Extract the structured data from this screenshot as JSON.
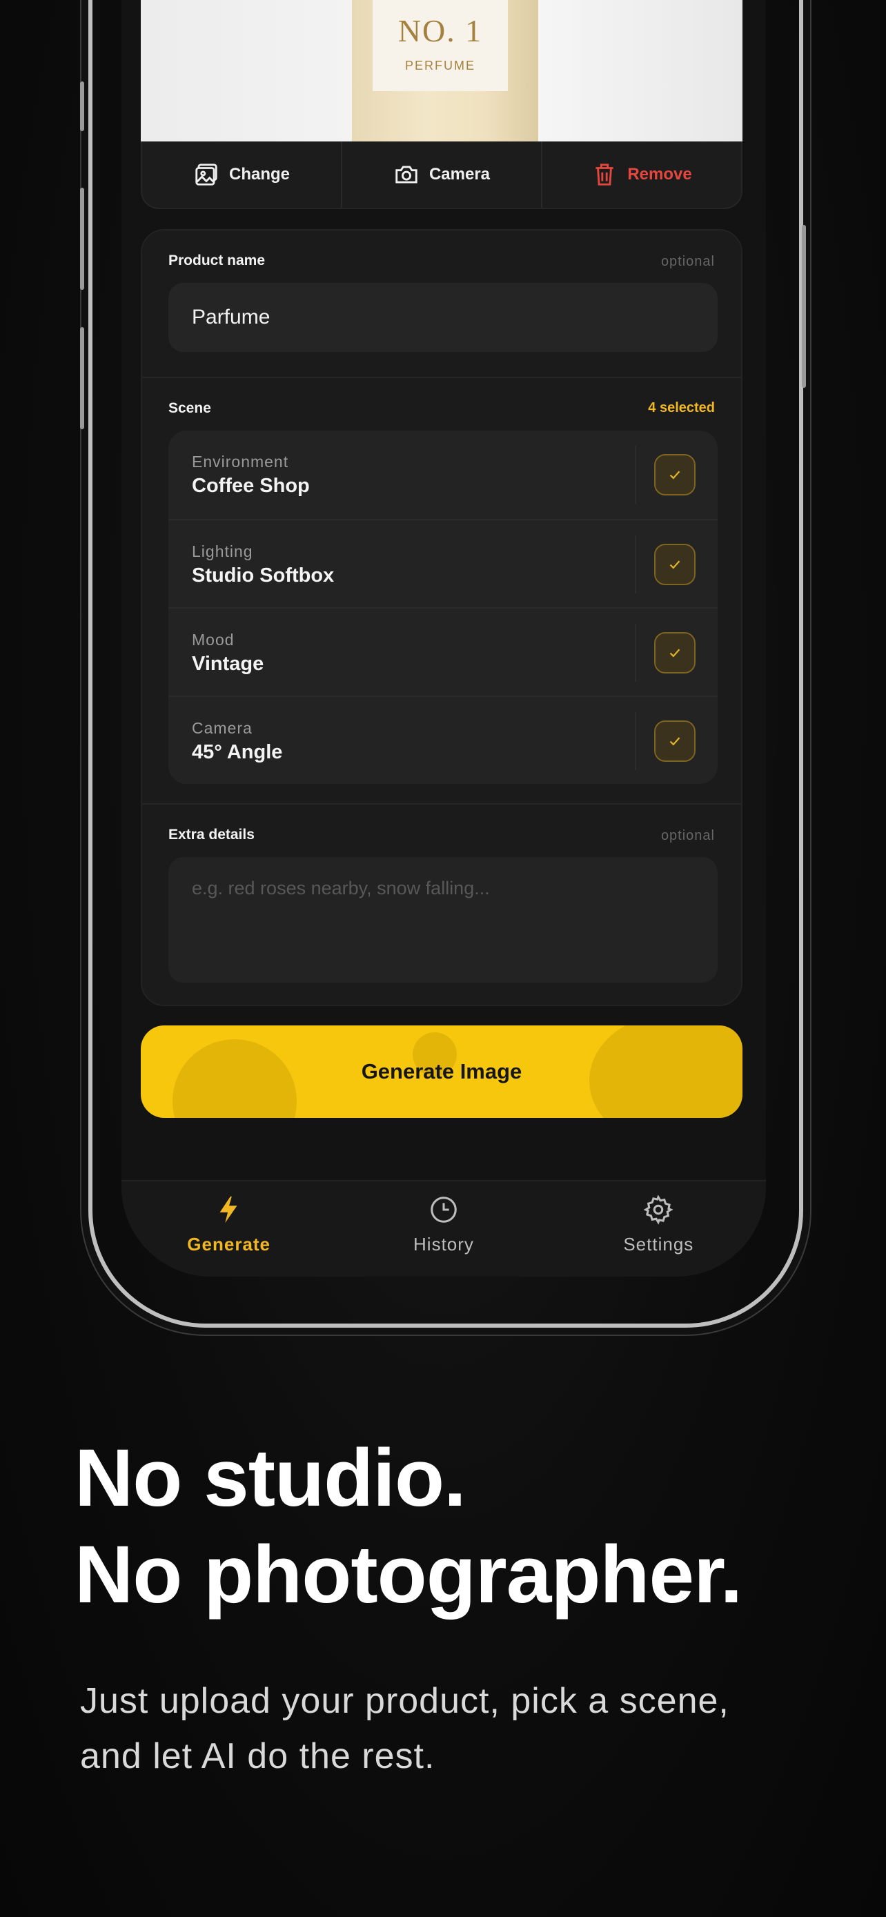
{
  "product_image": {
    "title": "NO. 1",
    "subtitle": "PERFUME"
  },
  "actions": {
    "change": "Change",
    "camera": "Camera",
    "remove": "Remove"
  },
  "form": {
    "product_name": {
      "label": "Product name",
      "aux": "optional",
      "value": "Parfume"
    },
    "scene": {
      "label": "Scene",
      "count": "4 selected",
      "items": [
        {
          "category": "Environment",
          "value": "Coffee Shop",
          "checked": true
        },
        {
          "category": "Lighting",
          "value": "Studio Softbox",
          "checked": true
        },
        {
          "category": "Mood",
          "value": "Vintage",
          "checked": true
        },
        {
          "category": "Camera",
          "value": "45° Angle",
          "checked": true
        }
      ]
    },
    "extra_details": {
      "label": "Extra details",
      "aux": "optional",
      "placeholder": "e.g. red roses nearby, snow falling..."
    }
  },
  "generate_button": "Generate Image",
  "tabs": [
    {
      "label": "Generate",
      "icon": "bolt-icon",
      "active": true
    },
    {
      "label": "History",
      "icon": "clock-icon",
      "active": false
    },
    {
      "label": "Settings",
      "icon": "gear-icon",
      "active": false
    }
  ],
  "headline": {
    "line1": "No studio.",
    "line2": "No photographer."
  },
  "subline": {
    "line1": "Just upload your product, pick a scene,",
    "line2": "and let AI do the rest."
  },
  "colors": {
    "accent": "#f2b824",
    "button": "#f7c70d",
    "danger": "#e5473f",
    "background": "#0b0b0b"
  }
}
